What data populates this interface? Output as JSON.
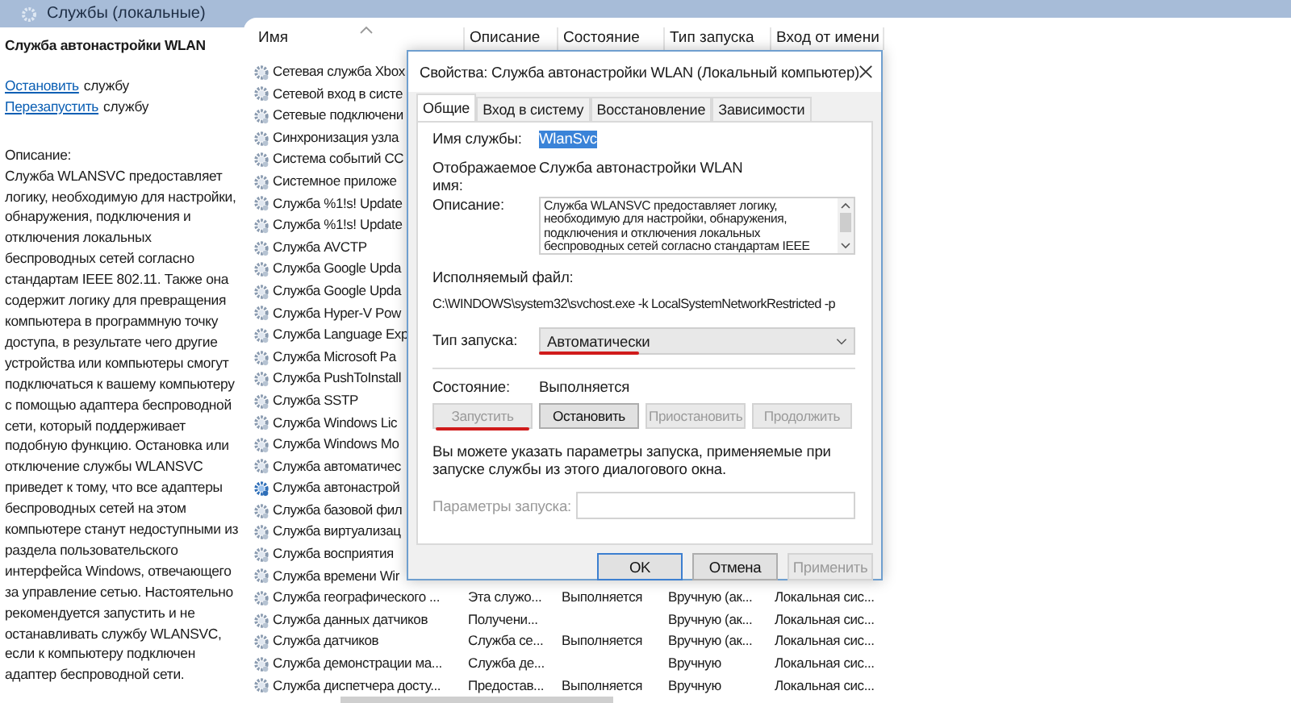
{
  "window": {
    "title": "Службы (локальные)"
  },
  "details": {
    "title": "Служба автонастройки WLAN",
    "actions": [
      {
        "link": "Остановить",
        "text": "службу"
      },
      {
        "link": "Перезапустить",
        "text": "службу"
      }
    ],
    "description_label": "Описание:",
    "description": "Служба WLANSVC предоставляет логику, необходимую для настройки, обнаружения, подключения и отключения локальных беспроводных сетей согласно стандартам IEEE 802.11. Также она содержит логику для превращения компьютера в программную точку доступа, в результате чего другие устройства или компьютеры смогут подключаться к вашему компьютеру с помощью адаптера беспроводной сети, который поддерживает подобную функцию. Остановка или отключение службы WLANSVC приведет к тому, что все адаптеры беспроводных сетей на этом компьютере станут недоступными из раздела пользовательского интерфейса Windows, отвечающего за управление сетью. Настоятельно рекомендуется запустить и не останавливать службу WLANSVC, если к компьютеру подключен адаптер беспроводной сети."
  },
  "table": {
    "columns": [
      "Имя",
      "Описание",
      "Состояние",
      "Тип запуска",
      "Вход от имени"
    ],
    "rows": [
      {
        "name": "Сетевая служба Xbox",
        "selected": false
      },
      {
        "name": "Сетевой вход в систе",
        "selected": false
      },
      {
        "name": "Сетевые подключени",
        "selected": false
      },
      {
        "name": "Синхронизация узла",
        "selected": false
      },
      {
        "name": "Система событий СС",
        "selected": false
      },
      {
        "name": "Системное приложе",
        "selected": false
      },
      {
        "name": "Служба %1!s! Update",
        "selected": false
      },
      {
        "name": "Служба %1!s! Update",
        "selected": false
      },
      {
        "name": "Служба AVCTP",
        "selected": false
      },
      {
        "name": "Служба Google Upda",
        "selected": false
      },
      {
        "name": "Служба Google Upda",
        "selected": false
      },
      {
        "name": "Служба Hyper-V Pow",
        "selected": false
      },
      {
        "name": "Служба Language Exp",
        "selected": false
      },
      {
        "name": "Служба Microsoft Pa",
        "selected": false
      },
      {
        "name": "Служба PushToInstall",
        "selected": false
      },
      {
        "name": "Служба SSTP",
        "selected": false
      },
      {
        "name": "Служба Windows Lic",
        "selected": false
      },
      {
        "name": "Служба Windows Mo",
        "selected": false
      },
      {
        "name": "Служба автоматичес",
        "selected": false
      },
      {
        "name": "Служба автонастрой",
        "selected": true
      },
      {
        "name": "Служба базовой фил",
        "selected": false
      },
      {
        "name": "Служба виртуализац",
        "selected": false
      },
      {
        "name": "Служба восприятия",
        "selected": false
      },
      {
        "name": "Служба времени Wir",
        "selected": false
      },
      {
        "name": "Служба географического ...",
        "description": "Эта служо...",
        "status": "Выполняется",
        "startup": "Вручную (ак...",
        "logon": "Локальная сис...",
        "selected": false
      },
      {
        "name": "Служба данных датчиков",
        "description": "Получени...",
        "startup": "Вручную (ак...",
        "logon": "Локальная сис...",
        "selected": false
      },
      {
        "name": "Служба датчиков",
        "description": "Служба се...",
        "status": "Выполняется",
        "startup": "Вручную (ак...",
        "logon": "Локальная сис...",
        "selected": false
      },
      {
        "name": "Служба демонстрации ма...",
        "description": "Служба де...",
        "startup": "Вручную",
        "logon": "Локальная сис...",
        "selected": false
      },
      {
        "name": "Служба диспетчера досту...",
        "description": "Предостав...",
        "status": "Выполняется",
        "startup": "Вручную",
        "logon": "Локальная сис...",
        "selected": false
      }
    ]
  },
  "dialog": {
    "title": "Свойства: Служба автонастройки WLAN (Локальный компьютер)",
    "tabs": [
      {
        "label": "Общие",
        "selected": true
      },
      {
        "label": "Вход в систему",
        "selected": false
      },
      {
        "label": "Восстановление",
        "selected": false
      },
      {
        "label": "Зависимости",
        "selected": false
      }
    ],
    "service_name": {
      "label": "Имя службы:",
      "value": "WlanSvc",
      "highlighted": true
    },
    "display_name": {
      "label": "Отображаемое имя:",
      "value": "Служба автонастройки WLAN"
    },
    "description": {
      "label": "Описание:",
      "value": "Служба WLANSVC предоставляет логику,\nнеобходимую для настройки, обнаружения,\nподключения и отключения локальных\nбеспроводных сетей согласно стандартам IEEE"
    },
    "executable": {
      "label": "Исполняемый файл:",
      "value": "C:\\WINDOWS\\system32\\svchost.exe -k LocalSystemNetworkRestricted -p"
    },
    "startup_type": {
      "label": "Тип запуска:",
      "value": "Автоматически",
      "underlined": true
    },
    "status": {
      "label": "Состояние:",
      "value": "Выполняется"
    },
    "service_buttons": [
      {
        "label": "Запустить",
        "disabled": true,
        "underlined": true
      },
      {
        "label": "Остановить",
        "disabled": false,
        "underlined": false
      },
      {
        "label": "Приостановить",
        "disabled": true,
        "underlined": false
      },
      {
        "label": "Продолжить",
        "disabled": true,
        "underlined": false
      }
    ],
    "hint": "Вы можете указать параметры запуска, применяемые при запуске службы из этого диалогового окна.",
    "start_params": {
      "label": "Параметры запуска:",
      "disabled": true
    },
    "buttons": [
      {
        "label": "OK",
        "default": true,
        "disabled": false
      },
      {
        "label": "Отмена",
        "default": false,
        "disabled": false
      },
      {
        "label": "Применить",
        "default": false,
        "disabled": true
      }
    ]
  }
}
